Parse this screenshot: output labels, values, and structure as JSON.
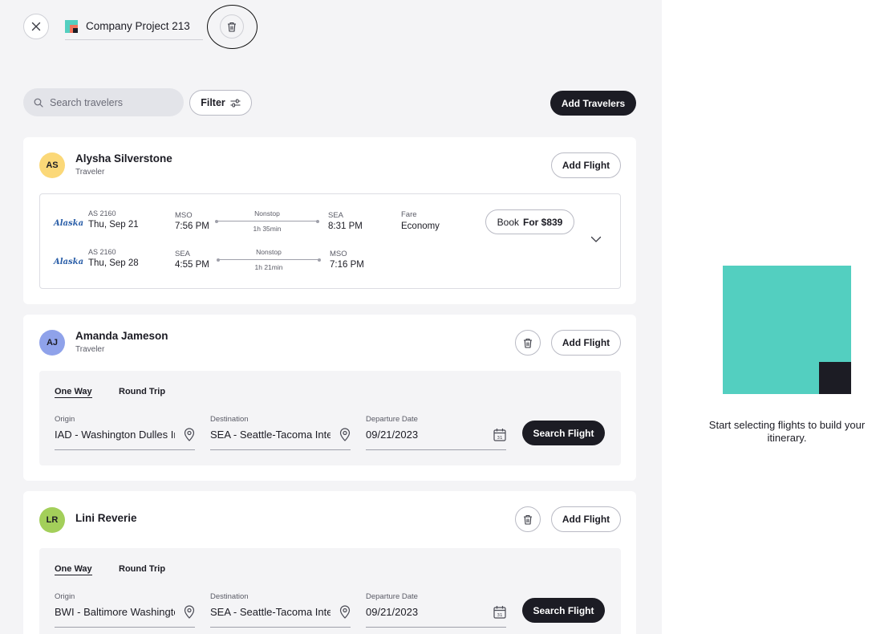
{
  "header": {
    "project_name": "Company Project 213"
  },
  "toolbar": {
    "search_placeholder": "Search travelers",
    "filter_label": "Filter",
    "add_travelers_label": "Add Travelers"
  },
  "travelers": [
    {
      "initials": "AS",
      "name": "Alysha Silverstone",
      "role": "Traveler",
      "avatar_color": "#fbd878",
      "add_flight_label": "Add Flight",
      "itinerary": {
        "segments": [
          {
            "airline": "Alaska",
            "flight_no": "AS 2160",
            "date": "Thu, Sep 21",
            "from_code": "MSO",
            "from_time": "7:56 PM",
            "stops": "Nonstop",
            "duration": "1h 35min",
            "to_code": "SEA",
            "to_time": "8:31 PM"
          },
          {
            "airline": "Alaska",
            "flight_no": "AS 2160",
            "date": "Thu, Sep 28",
            "from_code": "SEA",
            "from_time": "4:55 PM",
            "stops": "Nonstop",
            "duration": "1h 21min",
            "to_code": "MSO",
            "to_time": "7:16 PM"
          }
        ],
        "fare_label": "Fare",
        "fare_class": "Economy",
        "book_label": "Book",
        "book_price": "For $839"
      }
    },
    {
      "initials": "AJ",
      "name": "Amanda Jameson",
      "role": "Traveler",
      "avatar_color": "#8fa2ea",
      "add_flight_label": "Add Flight",
      "form": {
        "tab_one_way": "One Way",
        "tab_round_trip": "Round Trip",
        "origin_label": "Origin",
        "origin_value": "IAD - Washington Dulles International",
        "destination_label": "Destination",
        "destination_value": "SEA - Seattle-Tacoma International",
        "date_label": "Departure Date",
        "date_value": "09/21/2023",
        "search_label": "Search Flight"
      }
    },
    {
      "initials": "LR",
      "name": "Lini Reverie",
      "role": "",
      "avatar_color": "#a3cf5a",
      "add_flight_label": "Add Flight",
      "form": {
        "tab_one_way": "One Way",
        "tab_round_trip": "Round Trip",
        "origin_label": "Origin",
        "origin_value": "BWI - Baltimore Washington International",
        "destination_label": "Destination",
        "destination_value": "SEA - Seattle-Tacoma International",
        "date_label": "Departure Date",
        "date_value": "09/21/2023",
        "search_label": "Search Flight"
      }
    }
  ],
  "right_panel": {
    "empty_message": "Start selecting flights to build your itinerary."
  },
  "colors": {
    "accent_dark": "#1c1c24",
    "illustration_teal": "#53cfc0",
    "airline_blue": "#2a5ea8"
  },
  "icons": [
    "close-icon",
    "trash-icon",
    "search-icon",
    "sliders-icon",
    "chevron-down-icon",
    "location-pin-icon",
    "calendar-icon"
  ]
}
